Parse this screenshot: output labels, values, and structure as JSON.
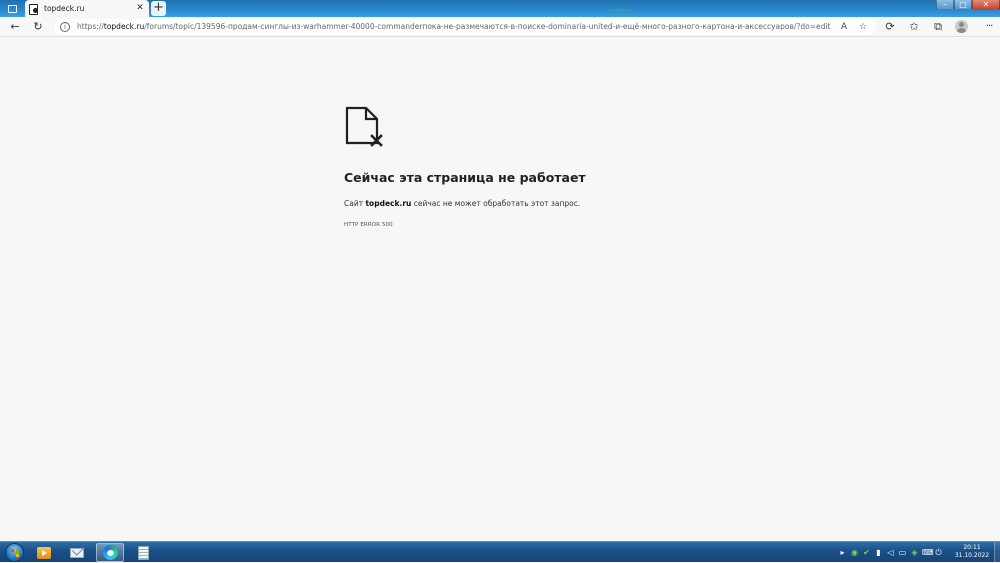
{
  "browser": {
    "tab": {
      "title": "topdeck.ru",
      "close": "✕"
    },
    "new_tab": "+",
    "window_controls": {
      "minimize": "–",
      "maximize": "□",
      "close": "✕"
    },
    "toolbar": {
      "back": "←",
      "reload": "↻"
    },
    "address": {
      "info": "i",
      "scheme": "https://",
      "host": "topdeck.ru",
      "path": "/forums/topic/139596-продам-синглы-из-warhammer-40000-commanderпока-не-размечаются-в-поиске-dominaria-united-и-ещё-много-разного-картона-и-аксессуаров/?do=edit",
      "read_aloud": "A",
      "favorite": "☆"
    },
    "actions": {
      "extensions": "⟳",
      "favorites": "✩",
      "collections": "⧉",
      "menu": "···"
    }
  },
  "error_page": {
    "title": "Сейчас эта страница не работает",
    "desc_prefix": "Сайт ",
    "desc_host": "topdeck.ru",
    "desc_suffix": " сейчас не может обработать этот запрос.",
    "code": "HTTP ERROR 500"
  },
  "taskbar": {
    "tray_icons": [
      "shield-icon",
      "network-status-icon",
      "antivirus-icon",
      "signal-icon",
      "volume-icon",
      "battery-icon",
      "nvidia-icon",
      "keyboard-icon",
      "power-icon"
    ],
    "tray_glyphs": [
      "▸",
      "◉",
      "✔",
      "▮",
      "◁",
      "▭",
      "◈",
      "⌨",
      "⏻"
    ],
    "time": "20:11",
    "date": "31.10.2022"
  }
}
